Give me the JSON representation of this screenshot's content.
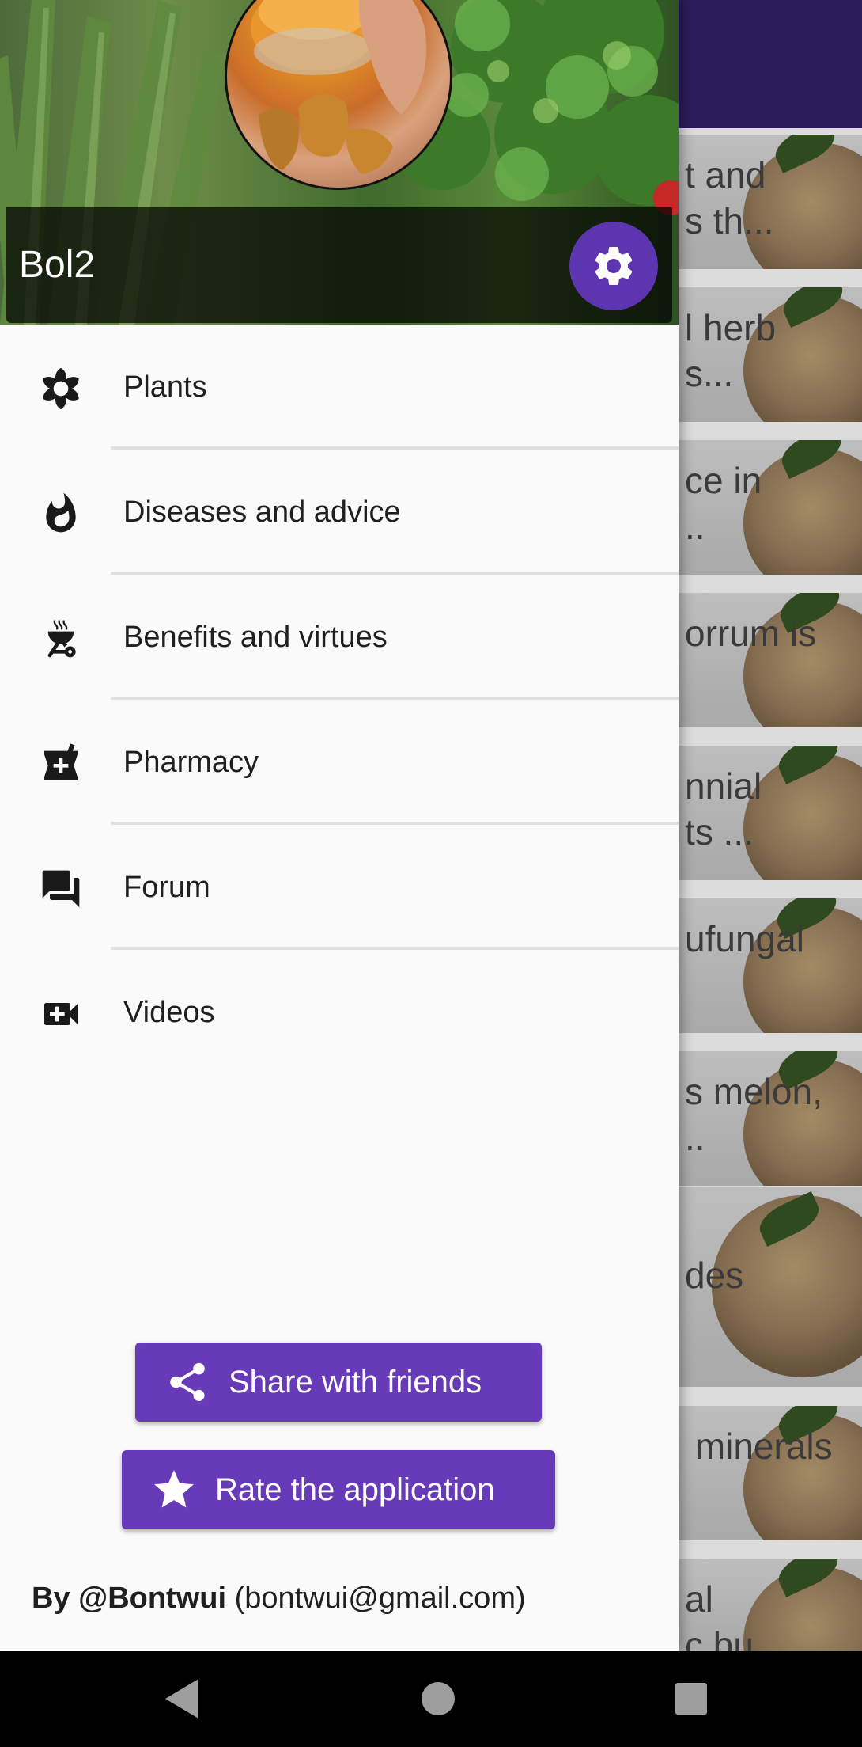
{
  "background_list": {
    "snippets": [
      "t and\ns th...",
      "l herb\ns...",
      "ce in\n..",
      "orrum is",
      "nnial\nts ...",
      "ufungal",
      "s melon,\n..",
      "des",
      " minerals",
      "al\nc bu..."
    ]
  },
  "drawer": {
    "header": {
      "username": "Bol2"
    },
    "menu": {
      "items": [
        {
          "label": "Plants",
          "icon": "flower-icon"
        },
        {
          "label": "Diseases and advice",
          "icon": "fire-icon"
        },
        {
          "label": "Benefits and virtues",
          "icon": "grill-icon"
        },
        {
          "label": "Pharmacy",
          "icon": "pharmacy-icon"
        },
        {
          "label": "Forum",
          "icon": "forum-icon"
        },
        {
          "label": "Videos",
          "icon": "video-call-icon"
        }
      ]
    },
    "share_label": "Share with friends",
    "rate_label": "Rate the application",
    "author": {
      "name": "By @Bontwui",
      "email": "(bontwui@gmail.com)"
    }
  },
  "colors": {
    "accent": "#673ab7",
    "settings_button": "#5e35b1",
    "appbar": "#2c1b5c"
  }
}
